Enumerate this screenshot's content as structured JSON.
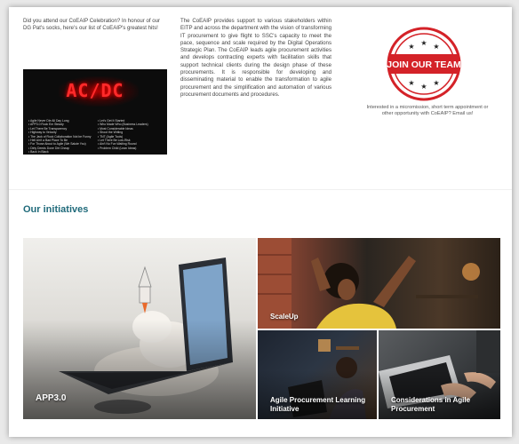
{
  "intro": {
    "text": "Did you attend our CoEAIP Celebration? In honour of our DG Pat's socks, here's our list of CoEAIP's greatest hits!"
  },
  "video": {
    "title": "AC/DC",
    "tracks_left": [
      "Agile Never Die All Day Long",
      "APP3.0 Rock Em Steady",
      "Let There Be Transparency",
      "Highway to Velocity",
      "The Jack of Rock Collaboration Not be Funny",
      "Hell Ain't a Bad Place To Be",
      "For Those About to Agile (We Salute You)",
      "Dirty Deeds Done Dirt Cheap",
      "Back In Black"
    ],
    "tracks_right": [
      "Let's Get It Started",
      "Who Made Who (Business Leaders)",
      "Most Considerable Ideas",
      "Shoot the Writing",
      "TNT (Agile Tools)",
      "Let There Be Low-Risk",
      "Ain't No Fun Waiting Round",
      "Problem Child (Lean Ideas)"
    ]
  },
  "about": {
    "text": "The CoEAIP provides support to various stakeholders within EITP and across the department with the vision of transforming IT procurement to give flight to SSC's capacity to meet the pace, sequence and scale required by the Digital Operations Strategic Plan. The CoEAIP leads agile procurement activities and develops contracting experts with facilitation skills that support technical clients during the design phase of these procurements. It is responsible for developing and disseminating material to enable the transformation to agile procurement and the simplification and automation of various procurement documents and procedures."
  },
  "join": {
    "badge_text": "JOIN OUR TEAM",
    "caption": "Interested in a micromission, short term appointment or other opportunity with CoEAIP? Email us!",
    "badge_color": "#d42228"
  },
  "initiatives": {
    "title": "Our initiatives",
    "tiles": [
      {
        "label": "APP3.0"
      },
      {
        "label": "ScaleUp"
      },
      {
        "label": "Agile Procurement Learning Initiative"
      },
      {
        "label": "Considerations in Agile Procurement"
      }
    ]
  },
  "colors": {
    "heading_accent": "#1f6a7a"
  }
}
